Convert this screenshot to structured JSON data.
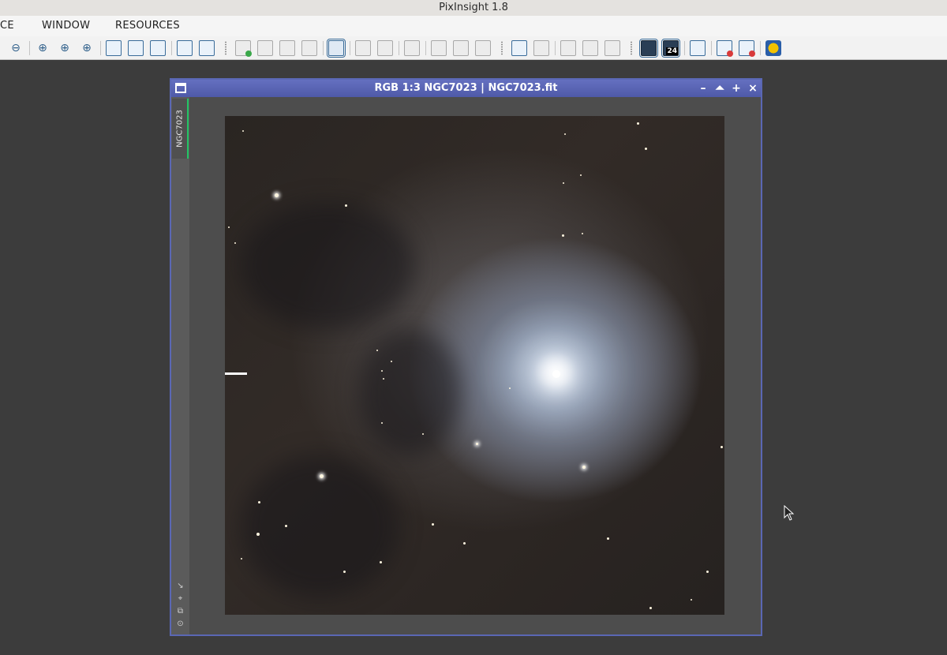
{
  "app": {
    "title": "PixInsight 1.8"
  },
  "menu": {
    "items": [
      "CE",
      "WINDOW",
      "RESOURCES"
    ]
  },
  "toolbar": {
    "zoom_badge": "24"
  },
  "image_window": {
    "title": "RGB 1:3 NGC7023 | NGC7023.fit",
    "identifier": "NGC7023",
    "buttons": {
      "minimize": "–",
      "shade": "⏶",
      "maximize": "+",
      "close": "×"
    }
  },
  "colors": {
    "window_accent": "#5a67b4",
    "identifier_tab_accent": "#22c464"
  }
}
